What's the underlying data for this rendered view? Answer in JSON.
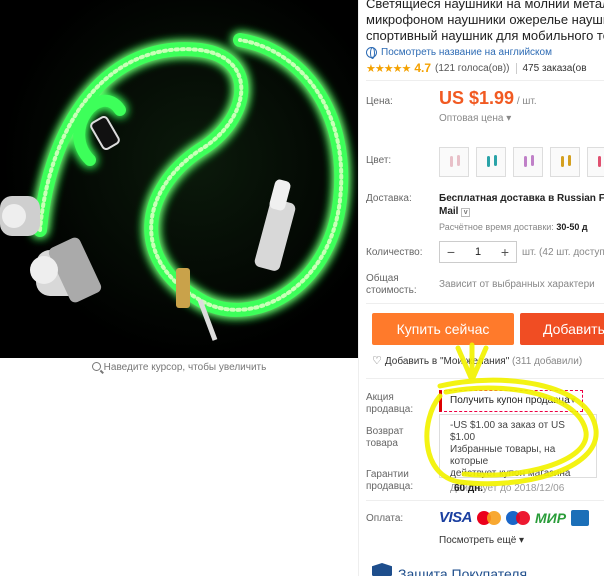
{
  "product": {
    "title_lines": [
      "Светящиеся наушники на молнии металл",
      "микрофоном наушники ожерелье наушн",
      "спортивный наушник для мобильного те"
    ],
    "translate_link": "Посмотреть название на английском",
    "rating": "4.7",
    "votes": "(121 голоса(ов))",
    "orders": "475 заказа(ов",
    "zoom_hint": "Наведите курсор, чтобы увеличить"
  },
  "price": {
    "label": "Цена:",
    "value": "US $1.99",
    "unit": "/ шт.",
    "wholesale": "Оптовая цена"
  },
  "color": {
    "label": "Цвет:",
    "swatches": [
      "#e8c0c8",
      "#2aa3a8",
      "#c080c8",
      "#d4a020",
      "#e05070"
    ]
  },
  "shipping": {
    "label": "Доставка:",
    "method": "Бесплатная доставка в Russian Fe",
    "method_line2": "Mail",
    "time_label": "Расчётное время доставки:",
    "time_value": "30-50 д"
  },
  "quantity": {
    "label": "Количество:",
    "minus": "−",
    "value": "1",
    "plus": "+",
    "note": "шт. (42 шт. доступ"
  },
  "total": {
    "label_line1": "Общая",
    "label_line2": "стоимость:",
    "value": "Зависит от выбранных характери"
  },
  "buttons": {
    "buy": "Купить сейчас",
    "cart": "Добавить"
  },
  "wishlist": {
    "label": "Добавить в \"Мои желания\"",
    "count": "(311 добавили)"
  },
  "seller_promo": {
    "label_line1": "Акция",
    "label_line2": "продавца:",
    "select_text": "Получить купон продавца",
    "coupon_line1": "-US $1.00 за заказ от US $1.00",
    "coupon_line2": "Избранные товары, на которые",
    "coupon_line3": "действует купон магазина",
    "valid": "Действует до 2018/12/06"
  },
  "returns": {
    "label_line1": "Возврат",
    "label_line2": "товара"
  },
  "guarantee": {
    "label_line1": "Гарантии",
    "label_line2": "продавца:",
    "value": "60 дн."
  },
  "payment": {
    "label": "Оплата:",
    "visa": "VISA",
    "mir": "МИР",
    "see_all": "Посмотреть ещё"
  },
  "protection": {
    "title": "Защита Покупателя"
  },
  "colors": {
    "accent_orange": "#ff7a2b",
    "accent_red": "#f04d23",
    "price": "#f15a22",
    "link": "#2d6bb4",
    "highlight": "#f2f200"
  }
}
